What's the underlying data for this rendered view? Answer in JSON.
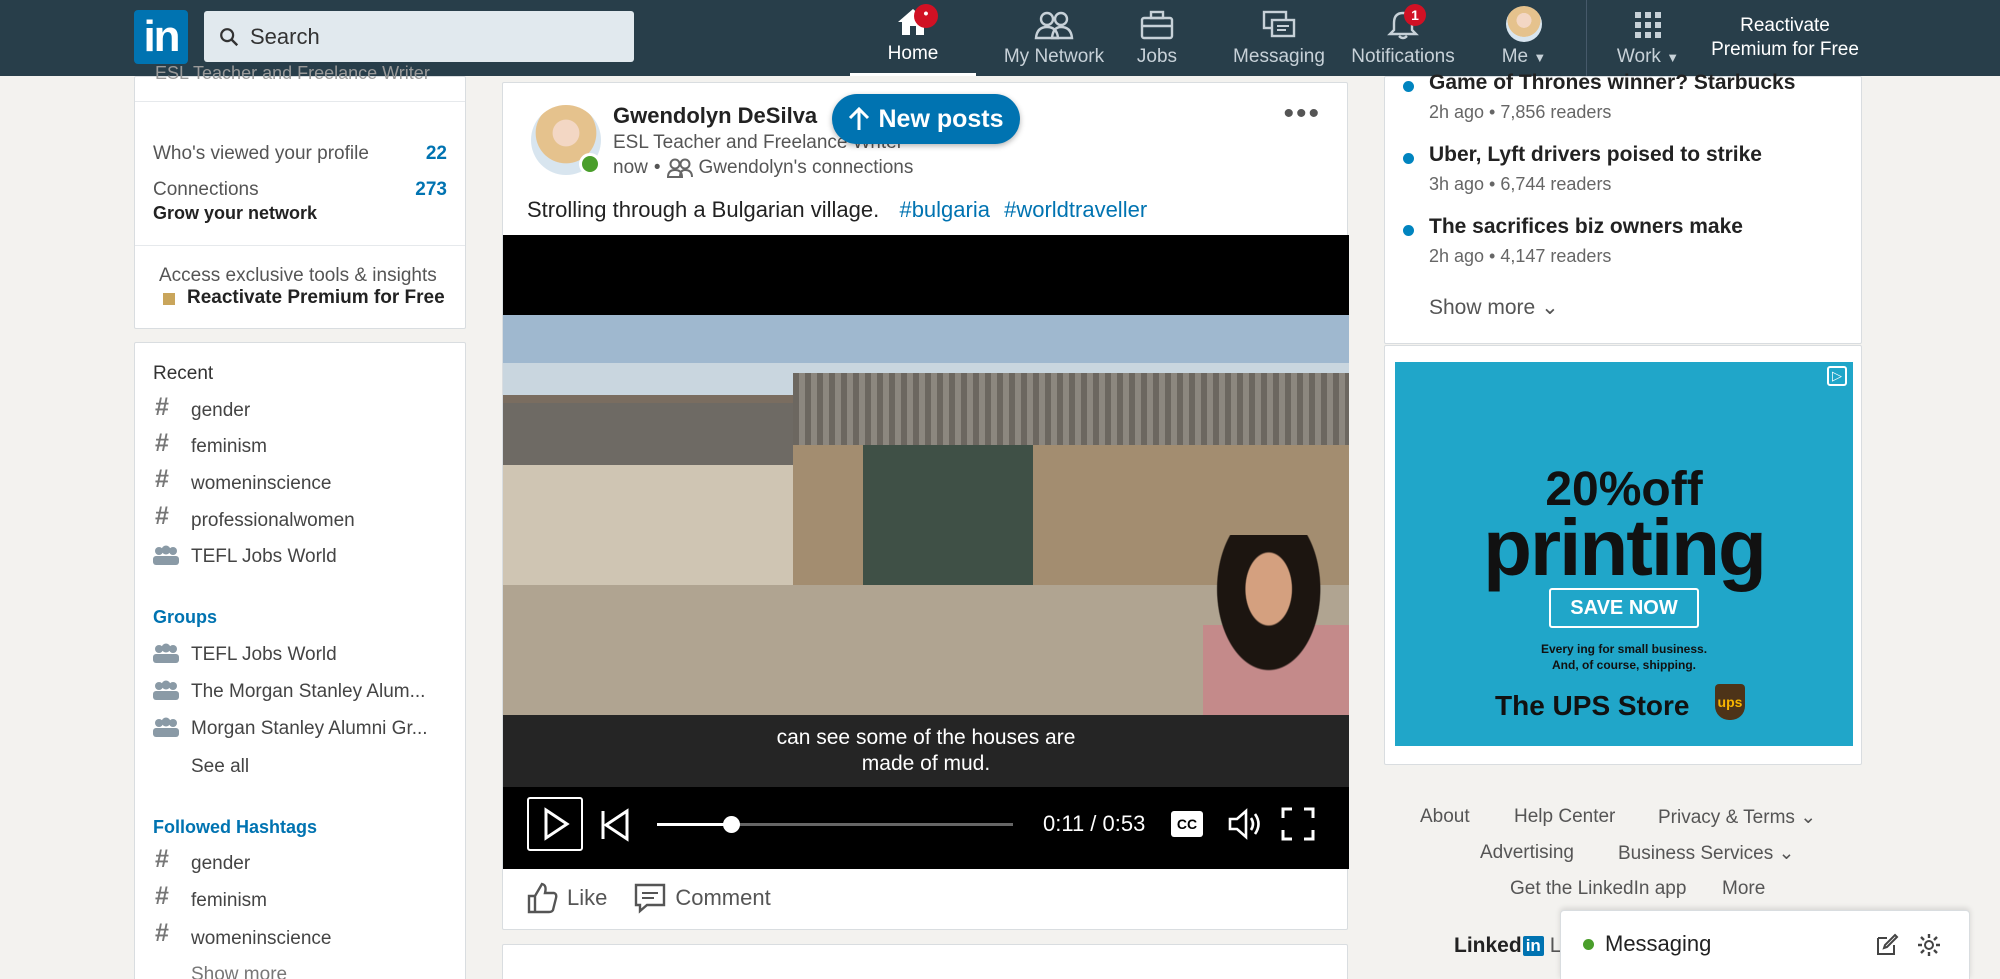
{
  "nav": {
    "logo": "in",
    "search_placeholder": "Search",
    "items": [
      {
        "label": "Home"
      },
      {
        "label": "My Network"
      },
      {
        "label": "Jobs"
      },
      {
        "label": "Messaging"
      },
      {
        "label": "Notifications",
        "badge": "1"
      },
      {
        "label": "Me"
      },
      {
        "label": "Work"
      }
    ],
    "premium_line1": "Reactivate",
    "premium_line2": "Premium for Free"
  },
  "profile_card": {
    "headline_cut": "ESL Teacher and Freelance Writer",
    "viewed_label": "Who's viewed your profile",
    "viewed_count": "22",
    "connections_label": "Connections",
    "connections_count": "273",
    "grow_label": "Grow your network",
    "premium_prompt": "Access exclusive tools & insights",
    "premium_link": "Reactivate Premium for Free"
  },
  "community": {
    "recent_title": "Recent",
    "recent": [
      "gender",
      "feminism",
      "womeninscience",
      "professionalwomen",
      "TEFL Jobs World"
    ],
    "groups_title": "Groups",
    "groups": [
      "TEFL Jobs World",
      "The Morgan Stanley Alum...",
      "Morgan Stanley Alumni Gr..."
    ],
    "see_all": "See all",
    "hashtags_title": "Followed Hashtags",
    "hashtags": [
      "gender",
      "feminism",
      "womeninscience"
    ],
    "show_more": "Show more"
  },
  "post": {
    "author": "Gwendolyn DeSilva",
    "headline": "ESL Teacher and Freelance Writer",
    "time": "now",
    "visibility": "Gwendolyn's connections",
    "text": "Strolling through a Bulgarian village.",
    "tags": [
      "#bulgaria",
      "#worldtraveller"
    ],
    "new_posts": "New posts",
    "caption_line1": "can see some of the houses are",
    "caption_line2": "made of mud.",
    "time_display": "0:11 / 0:53",
    "progress_fraction": 0.207,
    "cc_label": "CC",
    "like_label": "Like",
    "comment_label": "Comment"
  },
  "news": {
    "items": [
      {
        "title": "Game of Thrones winner? Starbucks",
        "meta": "2h ago • 7,856 readers"
      },
      {
        "title": "Uber, Lyft drivers poised to strike",
        "meta": "3h ago • 6,744 readers"
      },
      {
        "title": "The sacrifices biz owners make",
        "meta": "2h ago • 4,147 readers"
      }
    ],
    "show_more": "Show more"
  },
  "ad": {
    "headline": "20%off",
    "word": "printing",
    "cta": "SAVE NOW",
    "tagline1": "Every ing for small business.",
    "tagline2": "And, of course, shipping.",
    "brand": "The UPS Store",
    "badge": "ups"
  },
  "footer": {
    "links": [
      "About",
      "Help Center",
      "Privacy & Terms",
      "Advertising",
      "Business Services",
      "Get the LinkedIn app",
      "More"
    ],
    "brand": "Linked",
    "brand_cut": "Li"
  },
  "messaging": {
    "label": "Messaging"
  },
  "colors": {
    "nav_bg": "#283e4a",
    "brand_blue": "#0073b1",
    "badge_red": "#d11124",
    "online_green": "#4a9e2b"
  }
}
